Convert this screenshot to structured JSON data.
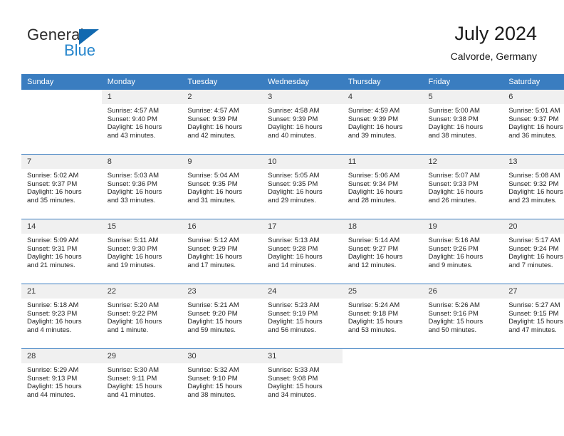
{
  "brand": {
    "word_one": "General",
    "word_two": "Blue",
    "triangle_color": "#1169b0",
    "blue_color": "#2585cc"
  },
  "header": {
    "title": "July 2024",
    "subtitle": "Calvorde, Germany",
    "accent_color": "#3a7dc0"
  },
  "calendar": {
    "weekday_headers": [
      "Sunday",
      "Monday",
      "Tuesday",
      "Wednesday",
      "Thursday",
      "Friday",
      "Saturday"
    ],
    "weeks": [
      [
        {
          "day": "",
          "sunrise": "",
          "sunset": "",
          "daylight_line1": "",
          "daylight_line2": "",
          "blank": true
        },
        {
          "day": "1",
          "sunrise": "Sunrise: 4:57 AM",
          "sunset": "Sunset: 9:40 PM",
          "daylight_line1": "Daylight: 16 hours",
          "daylight_line2": "and 43 minutes."
        },
        {
          "day": "2",
          "sunrise": "Sunrise: 4:57 AM",
          "sunset": "Sunset: 9:39 PM",
          "daylight_line1": "Daylight: 16 hours",
          "daylight_line2": "and 42 minutes."
        },
        {
          "day": "3",
          "sunrise": "Sunrise: 4:58 AM",
          "sunset": "Sunset: 9:39 PM",
          "daylight_line1": "Daylight: 16 hours",
          "daylight_line2": "and 40 minutes."
        },
        {
          "day": "4",
          "sunrise": "Sunrise: 4:59 AM",
          "sunset": "Sunset: 9:39 PM",
          "daylight_line1": "Daylight: 16 hours",
          "daylight_line2": "and 39 minutes."
        },
        {
          "day": "5",
          "sunrise": "Sunrise: 5:00 AM",
          "sunset": "Sunset: 9:38 PM",
          "daylight_line1": "Daylight: 16 hours",
          "daylight_line2": "and 38 minutes."
        },
        {
          "day": "6",
          "sunrise": "Sunrise: 5:01 AM",
          "sunset": "Sunset: 9:37 PM",
          "daylight_line1": "Daylight: 16 hours",
          "daylight_line2": "and 36 minutes."
        }
      ],
      [
        {
          "day": "7",
          "sunrise": "Sunrise: 5:02 AM",
          "sunset": "Sunset: 9:37 PM",
          "daylight_line1": "Daylight: 16 hours",
          "daylight_line2": "and 35 minutes."
        },
        {
          "day": "8",
          "sunrise": "Sunrise: 5:03 AM",
          "sunset": "Sunset: 9:36 PM",
          "daylight_line1": "Daylight: 16 hours",
          "daylight_line2": "and 33 minutes."
        },
        {
          "day": "9",
          "sunrise": "Sunrise: 5:04 AM",
          "sunset": "Sunset: 9:35 PM",
          "daylight_line1": "Daylight: 16 hours",
          "daylight_line2": "and 31 minutes."
        },
        {
          "day": "10",
          "sunrise": "Sunrise: 5:05 AM",
          "sunset": "Sunset: 9:35 PM",
          "daylight_line1": "Daylight: 16 hours",
          "daylight_line2": "and 29 minutes."
        },
        {
          "day": "11",
          "sunrise": "Sunrise: 5:06 AM",
          "sunset": "Sunset: 9:34 PM",
          "daylight_line1": "Daylight: 16 hours",
          "daylight_line2": "and 28 minutes."
        },
        {
          "day": "12",
          "sunrise": "Sunrise: 5:07 AM",
          "sunset": "Sunset: 9:33 PM",
          "daylight_line1": "Daylight: 16 hours",
          "daylight_line2": "and 26 minutes."
        },
        {
          "day": "13",
          "sunrise": "Sunrise: 5:08 AM",
          "sunset": "Sunset: 9:32 PM",
          "daylight_line1": "Daylight: 16 hours",
          "daylight_line2": "and 23 minutes."
        }
      ],
      [
        {
          "day": "14",
          "sunrise": "Sunrise: 5:09 AM",
          "sunset": "Sunset: 9:31 PM",
          "daylight_line1": "Daylight: 16 hours",
          "daylight_line2": "and 21 minutes."
        },
        {
          "day": "15",
          "sunrise": "Sunrise: 5:11 AM",
          "sunset": "Sunset: 9:30 PM",
          "daylight_line1": "Daylight: 16 hours",
          "daylight_line2": "and 19 minutes."
        },
        {
          "day": "16",
          "sunrise": "Sunrise: 5:12 AM",
          "sunset": "Sunset: 9:29 PM",
          "daylight_line1": "Daylight: 16 hours",
          "daylight_line2": "and 17 minutes."
        },
        {
          "day": "17",
          "sunrise": "Sunrise: 5:13 AM",
          "sunset": "Sunset: 9:28 PM",
          "daylight_line1": "Daylight: 16 hours",
          "daylight_line2": "and 14 minutes."
        },
        {
          "day": "18",
          "sunrise": "Sunrise: 5:14 AM",
          "sunset": "Sunset: 9:27 PM",
          "daylight_line1": "Daylight: 16 hours",
          "daylight_line2": "and 12 minutes."
        },
        {
          "day": "19",
          "sunrise": "Sunrise: 5:16 AM",
          "sunset": "Sunset: 9:26 PM",
          "daylight_line1": "Daylight: 16 hours",
          "daylight_line2": "and 9 minutes."
        },
        {
          "day": "20",
          "sunrise": "Sunrise: 5:17 AM",
          "sunset": "Sunset: 9:24 PM",
          "daylight_line1": "Daylight: 16 hours",
          "daylight_line2": "and 7 minutes."
        }
      ],
      [
        {
          "day": "21",
          "sunrise": "Sunrise: 5:18 AM",
          "sunset": "Sunset: 9:23 PM",
          "daylight_line1": "Daylight: 16 hours",
          "daylight_line2": "and 4 minutes."
        },
        {
          "day": "22",
          "sunrise": "Sunrise: 5:20 AM",
          "sunset": "Sunset: 9:22 PM",
          "daylight_line1": "Daylight: 16 hours",
          "daylight_line2": "and 1 minute."
        },
        {
          "day": "23",
          "sunrise": "Sunrise: 5:21 AM",
          "sunset": "Sunset: 9:20 PM",
          "daylight_line1": "Daylight: 15 hours",
          "daylight_line2": "and 59 minutes."
        },
        {
          "day": "24",
          "sunrise": "Sunrise: 5:23 AM",
          "sunset": "Sunset: 9:19 PM",
          "daylight_line1": "Daylight: 15 hours",
          "daylight_line2": "and 56 minutes."
        },
        {
          "day": "25",
          "sunrise": "Sunrise: 5:24 AM",
          "sunset": "Sunset: 9:18 PM",
          "daylight_line1": "Daylight: 15 hours",
          "daylight_line2": "and 53 minutes."
        },
        {
          "day": "26",
          "sunrise": "Sunrise: 5:26 AM",
          "sunset": "Sunset: 9:16 PM",
          "daylight_line1": "Daylight: 15 hours",
          "daylight_line2": "and 50 minutes."
        },
        {
          "day": "27",
          "sunrise": "Sunrise: 5:27 AM",
          "sunset": "Sunset: 9:15 PM",
          "daylight_line1": "Daylight: 15 hours",
          "daylight_line2": "and 47 minutes."
        }
      ],
      [
        {
          "day": "28",
          "sunrise": "Sunrise: 5:29 AM",
          "sunset": "Sunset: 9:13 PM",
          "daylight_line1": "Daylight: 15 hours",
          "daylight_line2": "and 44 minutes."
        },
        {
          "day": "29",
          "sunrise": "Sunrise: 5:30 AM",
          "sunset": "Sunset: 9:11 PM",
          "daylight_line1": "Daylight: 15 hours",
          "daylight_line2": "and 41 minutes."
        },
        {
          "day": "30",
          "sunrise": "Sunrise: 5:32 AM",
          "sunset": "Sunset: 9:10 PM",
          "daylight_line1": "Daylight: 15 hours",
          "daylight_line2": "and 38 minutes."
        },
        {
          "day": "31",
          "sunrise": "Sunrise: 5:33 AM",
          "sunset": "Sunset: 9:08 PM",
          "daylight_line1": "Daylight: 15 hours",
          "daylight_line2": "and 34 minutes."
        },
        {
          "day": "",
          "sunrise": "",
          "sunset": "",
          "daylight_line1": "",
          "daylight_line2": "",
          "blank": true
        },
        {
          "day": "",
          "sunrise": "",
          "sunset": "",
          "daylight_line1": "",
          "daylight_line2": "",
          "blank": true
        },
        {
          "day": "",
          "sunrise": "",
          "sunset": "",
          "daylight_line1": "",
          "daylight_line2": "",
          "blank": true
        }
      ]
    ]
  }
}
